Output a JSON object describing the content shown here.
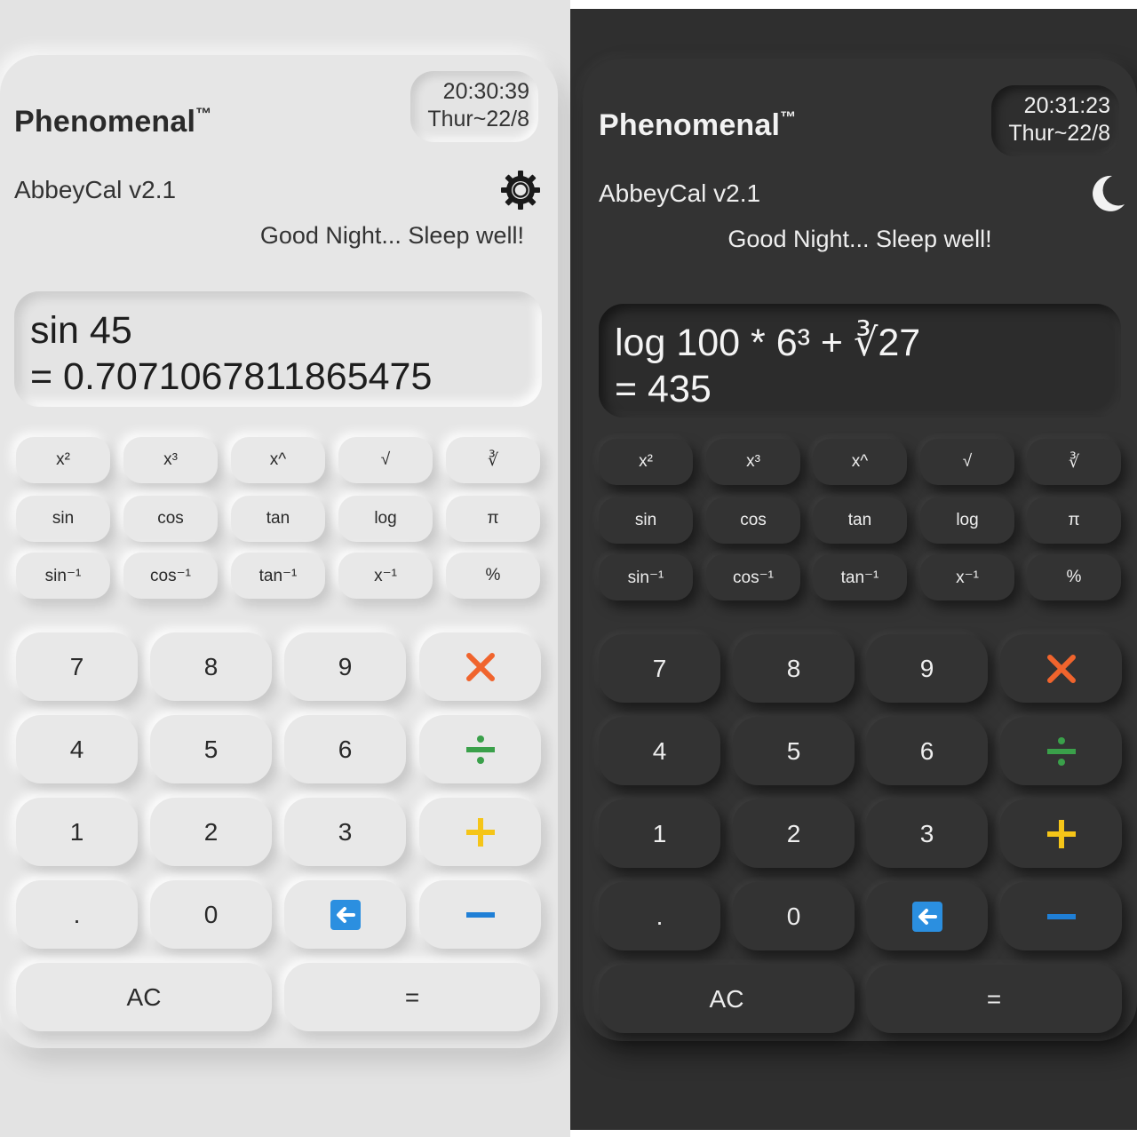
{
  "light": {
    "brand": "Phenomenal",
    "trademark": "™",
    "clock": {
      "time": "20:30:39",
      "date": "Thur~22/8"
    },
    "app_name": "AbbeyCal v2.1",
    "mode_icon": "gear-icon",
    "greeting": "Good Night... Sleep well!",
    "display": {
      "expression": "sin 45",
      "result": "= 0.7071067811865475"
    }
  },
  "dark": {
    "brand": "Phenomenal",
    "trademark": "™",
    "clock": {
      "time": "20:31:23",
      "date": "Thur~22/8"
    },
    "app_name": "AbbeyCal v2.1",
    "mode_icon": "moon-icon",
    "greeting": "Good Night... Sleep well!",
    "display": {
      "expression": "log 100 * 6³ + ∛27",
      "result": "= 435"
    }
  },
  "sci_keys": {
    "square": "x²",
    "cube": "x³",
    "power": "x^",
    "sqrt": "√",
    "cbrt": "∛",
    "sin": "sin",
    "cos": "cos",
    "tan": "tan",
    "log": "log",
    "pi": "π",
    "asin": "sin⁻¹",
    "acos": "cos⁻¹",
    "atan": "tan⁻¹",
    "inverse": "x⁻¹",
    "percent": "%"
  },
  "num_keys": {
    "seven": "7",
    "eight": "8",
    "nine": "9",
    "four": "4",
    "five": "5",
    "six": "6",
    "one": "1",
    "two": "2",
    "three": "3",
    "dot": ".",
    "zero": "0",
    "clear": "AC",
    "equals": "="
  },
  "op_icons": {
    "multiply": "multiply-icon",
    "divide": "divide-icon",
    "plus": "plus-icon",
    "backspace": "backspace-icon",
    "minus": "minus-icon"
  },
  "colors": {
    "multiply": "#f0642d",
    "divide": "#3aa04a",
    "plus": "#f5c518",
    "backspace": "#2b8fe0",
    "minus": "#1f7fd6",
    "light_bg": "#e6e6e6",
    "dark_bg": "#333333"
  }
}
